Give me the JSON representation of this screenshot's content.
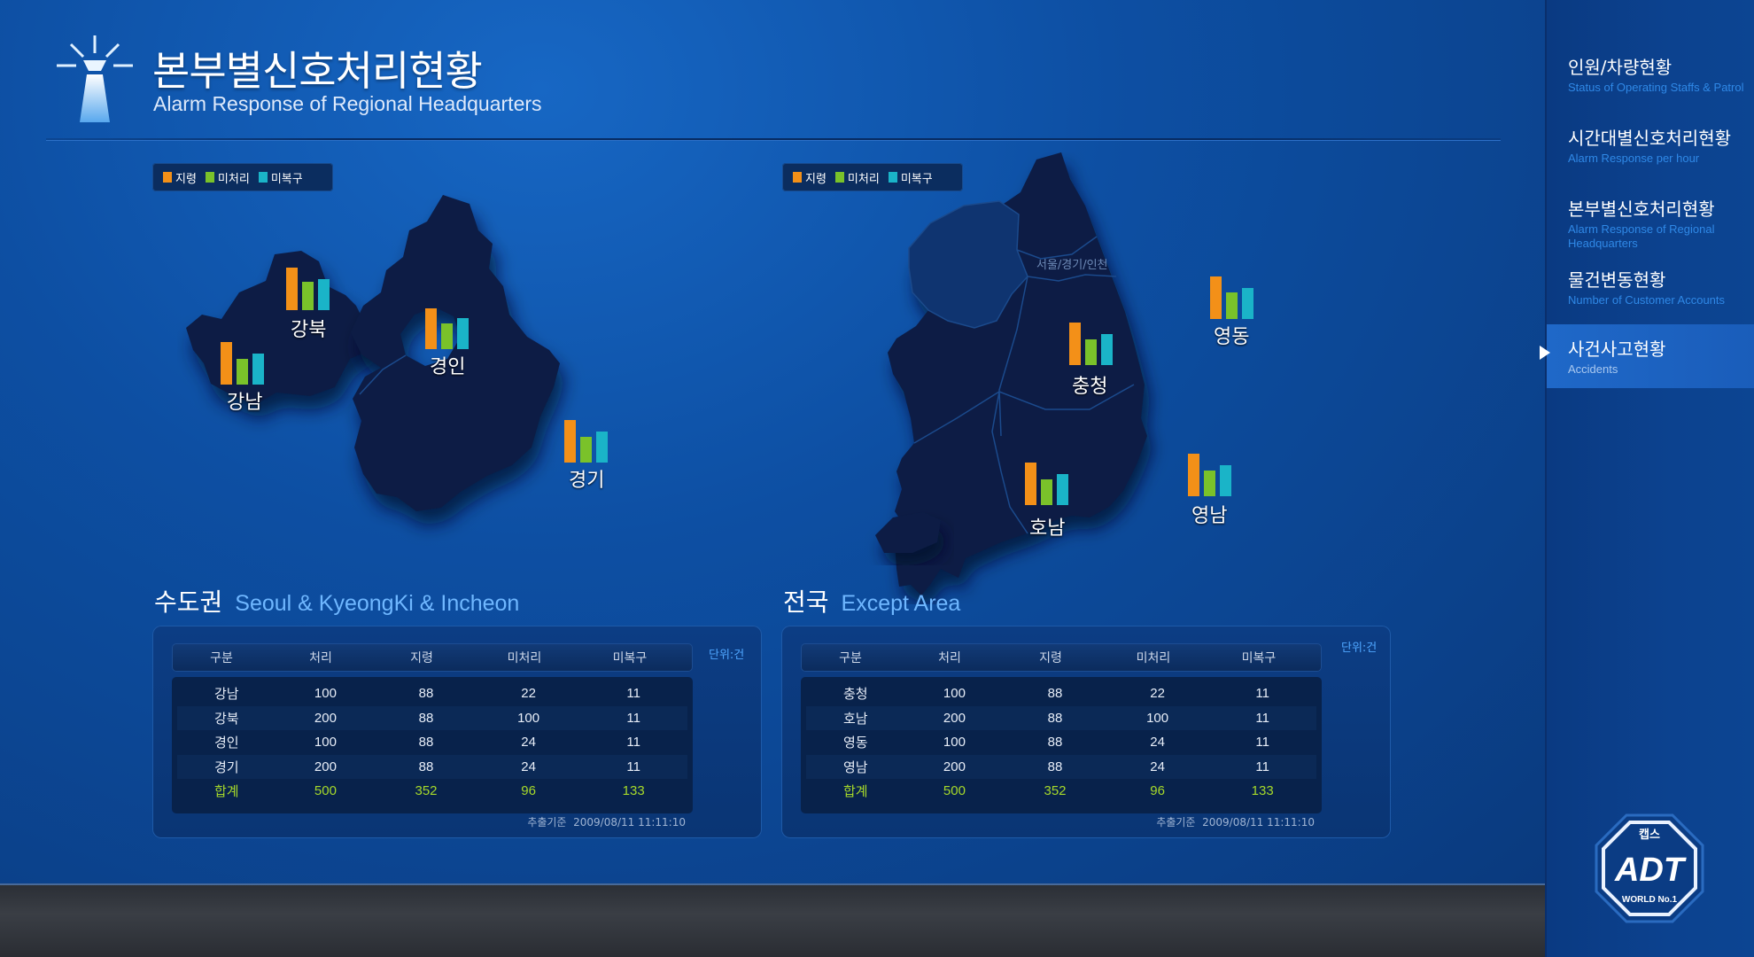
{
  "header": {
    "title": "본부별신호처리현황",
    "subtitle": "Alarm Response of Regional Headquarters"
  },
  "legend": [
    {
      "label": "지령",
      "color": "#f39018"
    },
    {
      "label": "미처리",
      "color": "#7ac22a"
    },
    {
      "label": "미복구",
      "color": "#1ab4c8"
    }
  ],
  "maps": {
    "metro": {
      "regions": [
        {
          "label": "강북",
          "values": [
            3,
            2,
            2.2
          ]
        },
        {
          "label": "강남",
          "values": [
            3,
            1.8,
            2.2
          ]
        },
        {
          "label": "경인",
          "values": [
            2.9,
            1.8,
            2.2
          ]
        },
        {
          "label": "경기",
          "values": [
            3,
            1.8,
            2.2
          ]
        }
      ]
    },
    "national": {
      "seoul_label": "서울/경기/인천",
      "regions": [
        {
          "label": "영동",
          "values": [
            3,
            1.9,
            2.2
          ]
        },
        {
          "label": "충청",
          "values": [
            3,
            1.8,
            2.2
          ]
        },
        {
          "label": "호남",
          "values": [
            3,
            1.8,
            2.2
          ]
        },
        {
          "label": "영남",
          "values": [
            3,
            1.8,
            2.2
          ]
        }
      ]
    }
  },
  "sections": {
    "metro": {
      "title_ko": "수도권",
      "title_en": "Seoul & KyeongKi & Incheon"
    },
    "national": {
      "title_ko": "전국",
      "title_en": "Except Area"
    }
  },
  "tables": {
    "headers": [
      "구분",
      "처리",
      "지령",
      "미처리",
      "미복구"
    ],
    "unit": "단위:건",
    "stamp_label": "추출기준",
    "stamp_value": "2009/08/11 11:11:10",
    "metro_rows": [
      [
        "강남",
        "100",
        "88",
        "22",
        "11"
      ],
      [
        "강북",
        "200",
        "88",
        "100",
        "11"
      ],
      [
        "경인",
        "100",
        "88",
        "24",
        "11"
      ],
      [
        "경기",
        "200",
        "88",
        "24",
        "11"
      ],
      [
        "합계",
        "500",
        "352",
        "96",
        "133"
      ]
    ],
    "national_rows": [
      [
        "충청",
        "100",
        "88",
        "22",
        "11"
      ],
      [
        "호남",
        "200",
        "88",
        "100",
        "11"
      ],
      [
        "영동",
        "100",
        "88",
        "24",
        "11"
      ],
      [
        "영남",
        "200",
        "88",
        "24",
        "11"
      ],
      [
        "합계",
        "500",
        "352",
        "96",
        "133"
      ]
    ]
  },
  "nav": [
    {
      "ko": "인원/차량현황",
      "en": "Status of Operating Staffs & Patrol"
    },
    {
      "ko": "시간대별신호처리현황",
      "en": "Alarm Response per hour"
    },
    {
      "ko": "본부별신호처리현황",
      "en": "Alarm Response of Regional Headquarters"
    },
    {
      "ko": "물건변동현황",
      "en": "Number of Customer Accounts"
    },
    {
      "ko": "사건사고현황",
      "en": "Accidents",
      "active": true
    }
  ],
  "brand": {
    "top": "캡스",
    "name": "ADT",
    "tagline": "WORLD No.1"
  }
}
